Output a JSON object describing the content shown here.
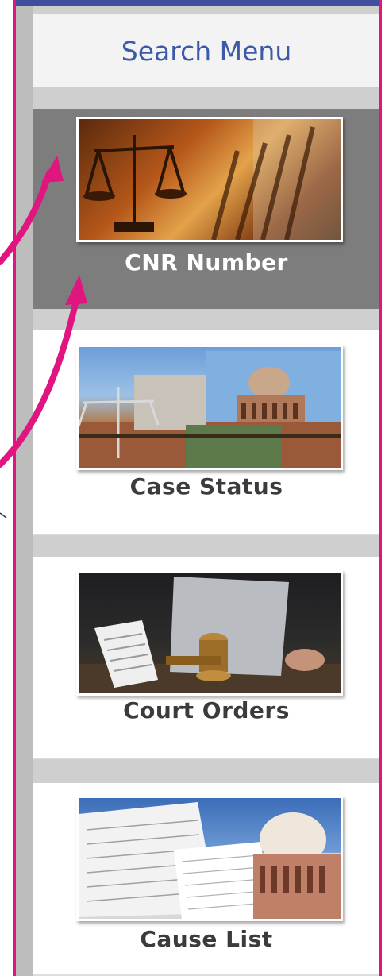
{
  "header": {
    "title": "Search Menu"
  },
  "menu": {
    "items": [
      {
        "label": "CNR Number",
        "icon": "scales-of-justice-image",
        "active": true
      },
      {
        "label": "Case Status",
        "icon": "supreme-court-building-image",
        "active": false
      },
      {
        "label": "Court Orders",
        "icon": "gavel-document-image",
        "active": false
      },
      {
        "label": "Cause List",
        "icon": "cause-list-court-dome-image",
        "active": false
      }
    ]
  },
  "colors": {
    "frame": "#e0157f",
    "header_text": "#3c5aa8",
    "active_card": "#7d7d7d",
    "arrow": "#e0157f"
  }
}
